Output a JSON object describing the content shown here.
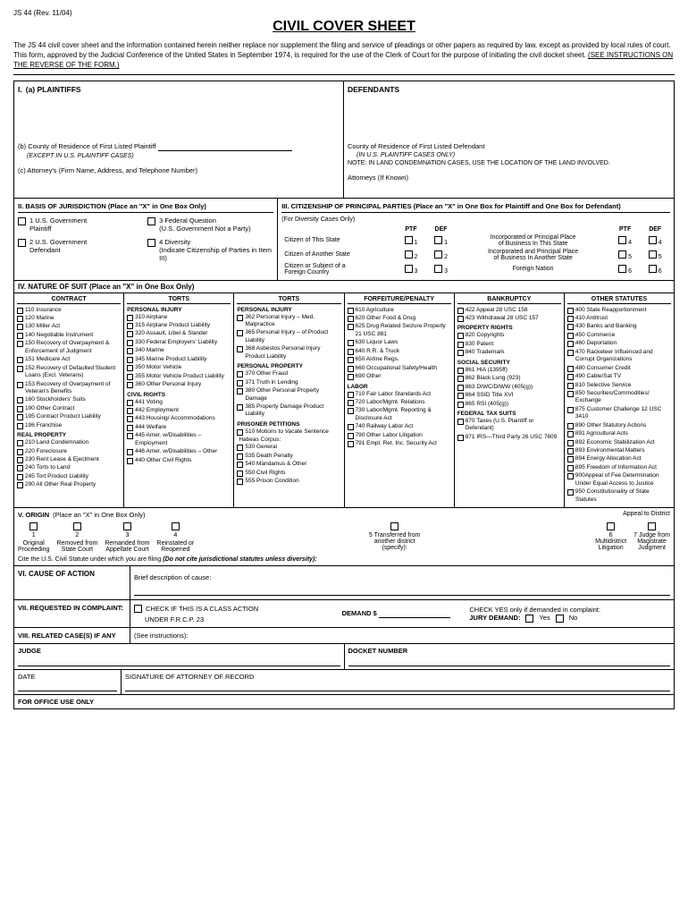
{
  "form_number": "JS 44 (Rev. 11/04)",
  "title": "CIVIL COVER SHEET",
  "intro": {
    "text": "The JS 44 civil cover sheet and the information contained herein neither replace nor supplement the filing and service of pleadings or other papers as required by law, except as provided by local rules of court. This form, approved by the Judicial Conference of the United States in September 1974, is required for the use of the Clerk of Court for the purpose of initiating the civil docket sheet.",
    "underline_text": "(SEE INSTRUCTIONS ON THE REVERSE OF THE FORM.)"
  },
  "section_i": {
    "label": "I.",
    "plaintiffs": {
      "label": "(a) PLAINTIFFS",
      "county_label": "(b) County of Residence of First Listed Plaintiff",
      "county_except": "(EXCEPT IN U.S. PLAINTIFF CASES)",
      "attorney_label": "(c) Attorney's (Firm Name, Address, and Telephone Number)"
    },
    "defendants": {
      "label": "DEFENDANTS",
      "county_label": "County of Residence of First Listed Defendant",
      "county_note": "(IN U.S. PLAINTIFF CASES ONLY)",
      "land_note": "NOTE:  IN LAND CONDEMNATION CASES, USE THE LOCATION OF THE LAND INVOLVED.",
      "attorneys_label": "Attorneys (If Known)"
    }
  },
  "section_ii": {
    "label": "II. BASIS OF JURISDICTION",
    "sublabel": "(Place an \"X\" in One Box Only)",
    "options": [
      {
        "num": "1",
        "text": "U.S. Government\nPlaintiff"
      },
      {
        "num": "3",
        "text": "Federal Question\n(U.S. Government Not a Party)"
      },
      {
        "num": "2",
        "text": "2 U.S. Government\nDefendant"
      },
      {
        "num": "4",
        "text": "4 Diversity\n(Indicate Citizenship of Parties in Item III)"
      }
    ]
  },
  "section_iii": {
    "label": "III. CITIZENSHIP OF PRINCIPAL PARTIES",
    "sublabel": "(Place an \"X\" in One Box for Plaintiff and One Box for Defendant)",
    "diversity_note": "(For Diversity Cases Only)",
    "rows": [
      {
        "label": "Citizen of This State",
        "ptf": "1",
        "def": "1",
        "description": "Incorporated or Principal Place of Business In This State",
        "ptf2": "4",
        "def2": "4"
      },
      {
        "label": "Citizen of Another State",
        "ptf": "2",
        "def": "2",
        "description": "Incorporated and Principal Place of Business In Another State",
        "ptf2": "5",
        "def2": "5"
      },
      {
        "label": "Citizen or Subject of a\nForeign Country",
        "ptf": "3",
        "def": "3",
        "description": "Foreign Nation",
        "ptf2": "6",
        "def2": "6"
      }
    ]
  },
  "section_iv": {
    "label": "IV. NATURE OF SUIT",
    "sublabel": "(Place an \"X\" in One Box Only)",
    "columns": {
      "contract": {
        "header": "CONTRACT",
        "items": [
          "110 Insurance",
          "120 Marine",
          "130 Miller Act",
          "140 Negotiable Instrument",
          "150 Recovery of Overpayment & Enforcement of Judgment",
          "151 Medicare Act",
          "152 Recovery of Defaulted Student Loans (Excl. Veterans)",
          "153 Recovery of Overpayment of Veteran's Benefits",
          "160 Stockholders' Suits",
          "190 Other Contract",
          "195 Contract Product Liability",
          "196 Franchise"
        ],
        "sub_sections": [
          {
            "header": "REAL PROPERTY",
            "items": [
              "210 Land Condemnation",
              "220 Foreclosure",
              "230 Rent Lease & Ejectment",
              "240 Torts to Land",
              "245 Tort Product Liability",
              "290 All Other Real Property"
            ]
          }
        ]
      },
      "torts": {
        "header": "TORTS",
        "sub_sections": [
          {
            "header": "PERSONAL INJURY",
            "items": [
              "310 Airplane",
              "315 Airplane Product Liability",
              "320 Assault, Libel & Slander",
              "330 Federal Employers' Liability",
              "340 Marine",
              "345 Marine Product Liability",
              "350 Motor Vehicle",
              "355 Motor Vehicle Product Liability",
              "360 Other Personal Injury"
            ]
          },
          {
            "header": "CIVIL RIGHTS",
            "items": [
              "441 Voting",
              "442 Employment",
              "443 Housing/ Accommodations",
              "444 Welfare",
              "445 Amer. w/Disabilities – Employment",
              "446 Amer. w/Disabilities – Other",
              "440 Other Civil Rights"
            ]
          }
        ]
      },
      "torts_personal_property": {
        "header": "TORTS",
        "sub_sections": [
          {
            "header": "PERSONAL INJURY",
            "items": [
              "362 Personal Injury – Med. Malpractice",
              "365 Personal Injury – of Product Liability",
              "368 Asbestos Personal Injury Product Liability"
            ]
          },
          {
            "header": "PERSONAL PROPERTY",
            "items": [
              "370 Other Fraud",
              "371 Truth in Lending",
              "380 Other Personal Property Damage",
              "385 Property Damage Product Liability"
            ]
          },
          {
            "header": "PRISONER PETITIONS",
            "items": [
              "510 Motions to Vacate Sentence",
              "Habeas Corpus:",
              "530 General",
              "535 Death Penalty",
              "540 Mandamus & Other",
              "550 Civil Rights",
              "555 Prison Condition"
            ]
          }
        ]
      },
      "forfeiture": {
        "header": "FORFEITURE/PENALTY",
        "items": [
          "610 Agriculture",
          "620 Other Food & Drug",
          "625 Drug Related Seizure Property 21 USC 881",
          "630 Liquor Laws",
          "640 R.R. & Truck",
          "650 Airline Regs.",
          "660 Occupational Safety/Health",
          "690 Other"
        ],
        "sub_sections": [
          {
            "header": "LABOR",
            "items": [
              "710 Fair Labor Standards Act",
              "720 Labor/Mgmt. Relations",
              "730 Labor/Mgmt. Reporting & Disclosure Act",
              "740 Railway Labor Act",
              "790 Other Labor Litigation",
              "791 Empl. Ret. Inc. Security Act"
            ]
          }
        ]
      },
      "bankruptcy": {
        "header": "BANKRUPTCY",
        "items": [
          "422 Appeal 28 USC 158",
          "423 Withdrawal 28 USC 157"
        ],
        "sub_sections": [
          {
            "header": "PROPERTY RIGHTS",
            "items": [
              "820 Copyrights",
              "830 Patent",
              "840 Trademark"
            ]
          },
          {
            "header": "SOCIAL SECURITY",
            "items": [
              "861 HIA (1395ff)",
              "862 Black Lung (923)",
              "863 DIWC/DIWW (405(g))",
              "864 SSID Title XVI",
              "865 RSI (405(g))"
            ]
          },
          {
            "header": "FEDERAL TAX SUITS",
            "items": [
              "870 Taxes (U.S. Plaintiff or Defendant)",
              "871 IRS—Third Party 26 USC 7609"
            ]
          }
        ]
      },
      "other_statutes": {
        "header": "OTHER STATUTES",
        "items": [
          "400 State Reapportionment",
          "410 Antitrust",
          "430 Banks and Banking",
          "450 Commerce",
          "460 Deportation",
          "470 Racketeer Influenced and Corrupt Organizations",
          "480 Consumer Credit",
          "490 Cable/Sat TV",
          "810 Selective Service",
          "850 Securities/Commodities/ Exchange",
          "875 Customer Challenge 12 USC 3410",
          "890 Other Statutory Actions",
          "891 Agricultural Acts",
          "892 Economic Stabilization Act",
          "893 Environmental Matters",
          "894 Energy Allocation Act",
          "895 Freedom of Information Act",
          "900Appeal of Fee Determination Under Equal Access to Justice",
          "950 Constitutionality of State Statutes"
        ]
      }
    }
  },
  "section_v": {
    "label": "V. ORIGIN",
    "sublabel": "(Place an \"X\" in One Box Only)",
    "options": [
      {
        "num": "1",
        "label": "Original\nProceeding"
      },
      {
        "num": "2",
        "label": ""
      },
      {
        "num": "3",
        "label": ""
      },
      {
        "num": "4",
        "label": ""
      },
      {
        "num": "5",
        "label": "5 Transferred from\nanother district\n(specify):"
      },
      {
        "num": "6",
        "label": "6\nMultidistrict\nLitigation"
      },
      {
        "num": "7",
        "label": "7 Judge from\nMagistrate\nJudgment"
      }
    ],
    "removed_label": "Removed from\nState Court",
    "remanded_label": "Remanded from\nAppellate Court",
    "reinstated_label": "Reinstated or\nReopened",
    "appeal_label": "Appeal to District",
    "cite_label": "Cite the U.S. Civil Statute under which you are filing",
    "cite_note": "(Do not cite jurisdictional statutes unless diversity):"
  },
  "section_vi": {
    "label": "VI. CAUSE OF ACTION",
    "brief_label": "Brief description of cause:"
  },
  "section_vii": {
    "label": "VII. REQUESTED IN\nCOMPLAINT:",
    "class_action_label": "CHECK IF THIS IS A CLASS ACTION",
    "under_label": "UNDER F.R.C.P. 23",
    "demand_label": "DEMAND $",
    "jury_label": "JURY DEMAND:",
    "check_yes_label": "CHECK YES only if demanded in complaint:",
    "yes_label": "Yes",
    "no_label": "No"
  },
  "section_viii": {
    "label": "VIII. RELATED CASE(S)\nIF ANY",
    "see_instructions": "(See instructions):",
    "judge_label": "JUDGE",
    "docket_label": "DOCKET NUMBER"
  },
  "bottom": {
    "date_label": "DATE",
    "signature_label": "SIGNATURE OF ATTORNEY OF RECORD",
    "office_label": "FOR OFFICE USE ONLY"
  }
}
